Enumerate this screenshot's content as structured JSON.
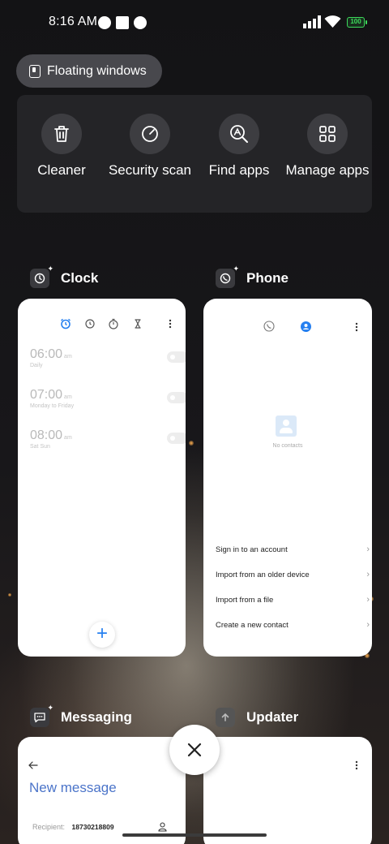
{
  "status_bar": {
    "time": "8:16 AM",
    "battery": "100",
    "battery_color": "#3ddc5b"
  },
  "floating_windows": {
    "label": "Floating windows",
    "icon": "floating-window-icon"
  },
  "tools": [
    {
      "label": "Cleaner",
      "icon": "trash-icon"
    },
    {
      "label": "Security scan",
      "icon": "security-scan-icon"
    },
    {
      "label": "Find apps",
      "icon": "find-apps-icon"
    },
    {
      "label": "Manage apps",
      "icon": "grid-apps-icon"
    }
  ],
  "apps": {
    "clock": {
      "name": "Clock",
      "tabs": [
        "alarm-icon",
        "clock-icon",
        "stopwatch-icon",
        "timer-icon"
      ],
      "alarms": [
        {
          "time": "06:00",
          "ampm": "am",
          "repeat": "Daily"
        },
        {
          "time": "07:00",
          "ampm": "am",
          "repeat": "Monday to Friday"
        },
        {
          "time": "08:00",
          "ampm": "am",
          "repeat": "Sat Sun"
        }
      ],
      "add_label": "+"
    },
    "phone": {
      "name": "Phone",
      "empty_text": "No contacts",
      "options": [
        "Sign in to an account",
        "Import from an older device",
        "Import from a file",
        "Create a new contact"
      ]
    },
    "messaging": {
      "name": "Messaging",
      "title": "New message",
      "recipient_label": "Recipient:",
      "recipient_value": "18730218809"
    },
    "updater": {
      "name": "Updater"
    }
  },
  "accent_color": "#2680f0"
}
